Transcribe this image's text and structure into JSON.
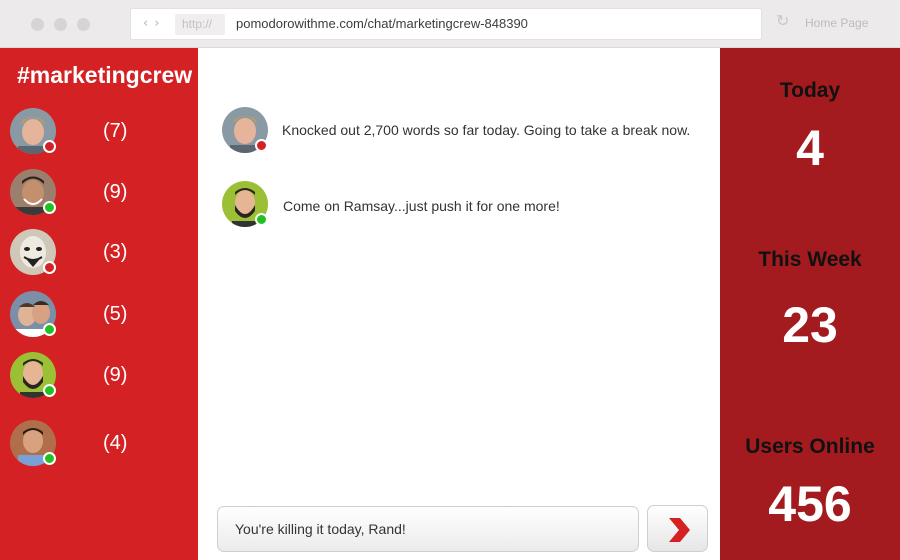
{
  "browser": {
    "url_protocol": "http://",
    "url": "pomodorowithme.com/chat/marketingcrew-848390",
    "home_label": "Home Page"
  },
  "sidebar": {
    "channel": "#marketingcrew",
    "members": [
      {
        "count": "(7)",
        "status": "away",
        "status_color": "#d42124"
      },
      {
        "count": "(9)",
        "status": "online",
        "status_color": "#22c022"
      },
      {
        "count": "(3)",
        "status": "away",
        "status_color": "#d42124"
      },
      {
        "count": "(5)",
        "status": "online",
        "status_color": "#22c022"
      },
      {
        "count": "(9)",
        "status": "online",
        "status_color": "#22c022"
      },
      {
        "count": "(4)",
        "status": "online",
        "status_color": "#22c022"
      }
    ]
  },
  "chat": {
    "messages": [
      {
        "text": "Knocked out 2,700 words so far today. Going to take a break now.",
        "status_color": "#d42124"
      },
      {
        "text": "Come on Ramsay...just push it for one more!",
        "status_color": "#22c022"
      }
    ],
    "input_value": "You're killing it today, Rand!"
  },
  "stats": {
    "today_label": "Today",
    "today_value": "4",
    "week_label": "This Week",
    "week_value": "23",
    "online_label": "Users Online",
    "online_value": "456"
  },
  "colors": {
    "sidebar_red": "#d42124",
    "stats_red": "#a31b1e",
    "online_green": "#22c022"
  }
}
